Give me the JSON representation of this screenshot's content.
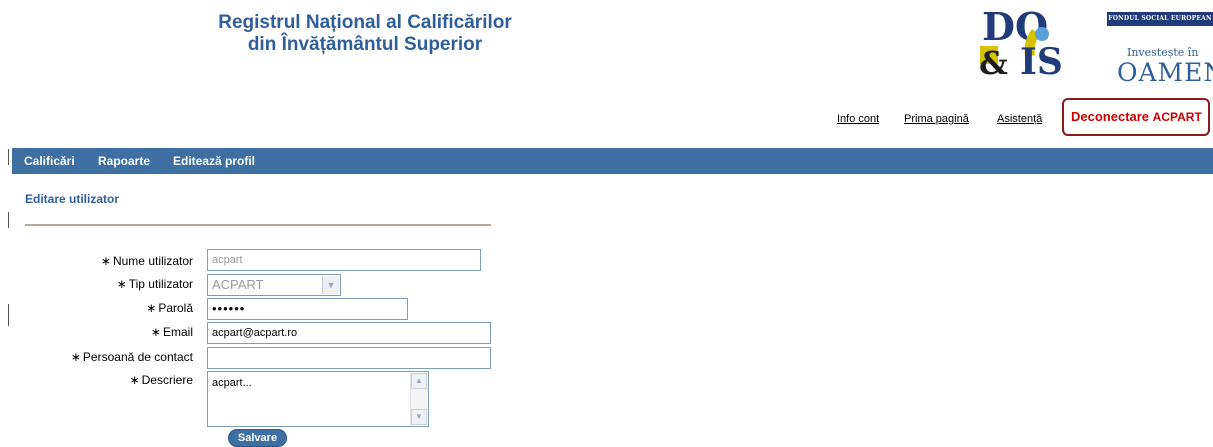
{
  "header": {
    "title_line1": "Registrul Național al Calificărilor",
    "title_line2": "din Învățământul Superior",
    "logo_docis": "DOCIS",
    "fse_top": "FONDUL SOCIAL EUROPEAN",
    "fse_small": "Investește în",
    "fse_big": "OAMENI"
  },
  "top_links": {
    "info": "Info cont",
    "home": "Prima pagină",
    "help": "Asistență",
    "logout": "Deconectare",
    "user": "ACPART"
  },
  "nav": {
    "items": [
      "Calificări",
      "Rapoarte",
      "Editează profil"
    ]
  },
  "page": {
    "title": "Editare utilizator"
  },
  "form": {
    "star": "∗",
    "username_label": "Nume utilizator",
    "username_value": "acpart",
    "type_label": "Tip utilizator",
    "type_value": "ACPART",
    "password_label": "Parolă",
    "password_value": "••••••",
    "email_label": "Email",
    "email_value": "acpart@acpart.ro",
    "contact_label": "Persoană de contact",
    "contact_value": "",
    "description_label": "Descriere",
    "description_value": "acpart...",
    "save_label": "Salvare"
  },
  "colors": {
    "nav_bg": "#3e6fa2",
    "title_blue": "#2f5f9a",
    "logout_red": "#cc0000"
  }
}
